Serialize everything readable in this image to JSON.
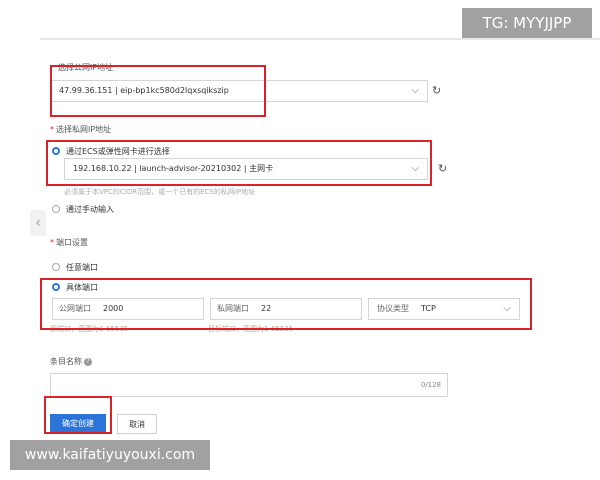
{
  "watermarks": {
    "top_right": "TG: MYYJJPP",
    "bottom_left": "www.kaifatiyuyouxi.com"
  },
  "public_ip": {
    "label": "选择公网IP地址",
    "value": "47.99.36.151 | eip-bp1kc580d2lqxsqikszip"
  },
  "private_ip": {
    "label": "选择私网IP地址",
    "required_mark": "*",
    "option_eni": "通过ECS或弹性网卡进行选择",
    "eni_value": "192.168.10.22 | launch-advisor-20210302 | 主网卡",
    "hint": "必须属于本VPC的CIDR范围，或一个已有的ECS的私网IP地址",
    "option_manual": "通过手动输入"
  },
  "port": {
    "label": "端口设置",
    "required_mark": "*",
    "option_any": "任意端口",
    "option_specific": "具体端口",
    "public_port_prefix": "公网端口",
    "public_port_value": "2000",
    "private_port_prefix": "私网端口",
    "private_port_value": "22",
    "protocol_prefix": "协议类型",
    "protocol_value": "TCP",
    "public_hint": "源端口，范围为1-65535",
    "private_hint": "目标端口，范围为1-65535"
  },
  "entry_name": {
    "label": "条目名称",
    "help": "?",
    "counter": "0/128"
  },
  "buttons": {
    "confirm": "确定创建",
    "cancel": "取消"
  },
  "icons": {
    "dropdown": "chevron-down-icon",
    "refresh": "refresh-icon",
    "collapse": "chevron-left-icon"
  },
  "colors": {
    "primary": "#2d74d9",
    "highlight": "#d9222a"
  }
}
